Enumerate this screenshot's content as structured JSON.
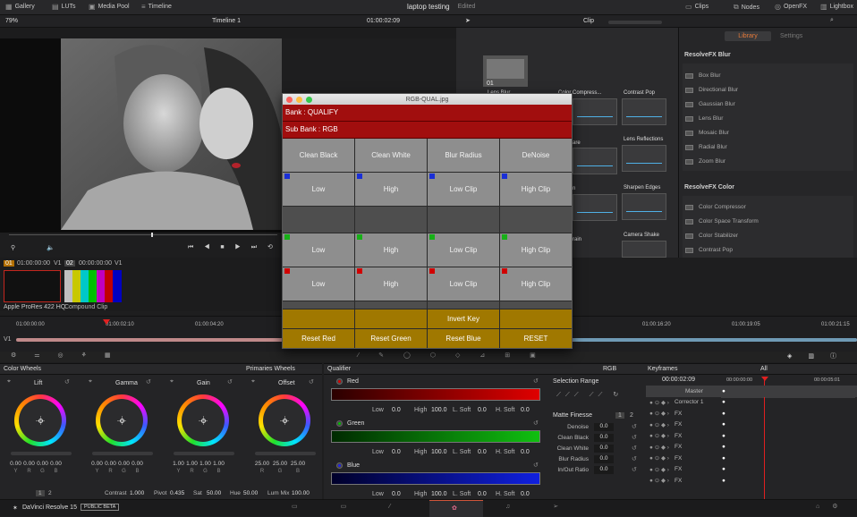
{
  "topbar": {
    "gallery": "Gallery",
    "luts": "LUTs",
    "media_pool": "Media Pool",
    "timeline": "Timeline",
    "project": "laptop testing",
    "edited": "Edited",
    "clips": "Clips",
    "nodes": "Nodes",
    "openfx": "OpenFX",
    "lightbox": "Lightbox"
  },
  "viewerbar": {
    "zoom": "79%",
    "timeline_name": "Timeline 1",
    "timecode": "01:00:02:09",
    "clip_mode": "Clip"
  },
  "library": {
    "tab_library": "Library",
    "tab_settings": "Settings",
    "blur_header": "ResolveFX Blur",
    "blur_items": [
      "Box Blur",
      "Directional Blur",
      "Gaussian Blur",
      "Lens Blur",
      "Mosaic Blur",
      "Radial Blur",
      "Zoom Blur"
    ],
    "color_header": "ResolveFX Color",
    "color_items": [
      "Color Compressor",
      "Color Space Transform",
      "Color Stabilizer",
      "Contrast Pop"
    ]
  },
  "nodes": {
    "node1_num": "01",
    "labels": {
      "lens_blur": "Lens Blur",
      "color_compress": "Color Compress...",
      "contrast_pop": "Contrast Pop",
      "lens_reflections": "Lens Reflections",
      "sharpen_edges": "Sharpen Edges",
      "camera_shake": "Camera Shake",
      "are": "are",
      "n": "n",
      "rain": "rain"
    }
  },
  "clips": {
    "clip1": {
      "num": "01",
      "tc": "01:00:00:00",
      "track": "V1",
      "name": "Apple ProRes 422 HQ"
    },
    "clip2": {
      "num": "02",
      "tc": "00:00:00:00",
      "track": "V1",
      "name": "Compound Clip"
    }
  },
  "timeline": {
    "t0": "01:00:00:00",
    "t1": "01:00:02:10",
    "t2": "01:00:04:20",
    "t3": "01:00:16:20",
    "t4": "01:00:19:05",
    "t5": "01:00:21:15",
    "track": "V1"
  },
  "color_wheels": {
    "title": "Color Wheels",
    "mode": "Primaries Wheels",
    "wheels": [
      {
        "name": "Lift",
        "vals": [
          "0.00",
          "0.00",
          "0.00",
          "0.00"
        ]
      },
      {
        "name": "Gamma",
        "vals": [
          "0.00",
          "0.00",
          "0.00",
          "0.00"
        ]
      },
      {
        "name": "Gain",
        "vals": [
          "1.00",
          "1.00",
          "1.00",
          "1.00"
        ]
      },
      {
        "name": "Offset",
        "vals": [
          "25.00",
          "25.00",
          "25.00"
        ]
      }
    ],
    "ch4": [
      "Y",
      "R",
      "G",
      "B"
    ],
    "ch3": [
      "R",
      "G",
      "B"
    ],
    "footer": {
      "page1": "1",
      "page2": "2",
      "contrast_label": "Contrast",
      "contrast": "1.000",
      "pivot_label": "Pivot",
      "pivot": "0.435",
      "sat_label": "Sat",
      "sat": "50.00",
      "hue_label": "Hue",
      "hue": "50.00",
      "lummix_label": "Lum Mix",
      "lummix": "100.00"
    }
  },
  "qualifier": {
    "title": "Qualifier",
    "mode": "RGB",
    "channels": [
      {
        "name": "Red",
        "low": "0.0",
        "high": "100.0",
        "lsoft": "0.0",
        "hsoft": "0.0"
      },
      {
        "name": "Green",
        "low": "0.0",
        "high": "100.0",
        "lsoft": "0.0",
        "hsoft": "0.0"
      },
      {
        "name": "Blue",
        "low": "0.0",
        "high": "100.0",
        "lsoft": "0.0",
        "hsoft": "0.0"
      }
    ],
    "labels": {
      "low": "Low",
      "high": "High",
      "lsoft": "L. Soft",
      "hsoft": "H. Soft"
    },
    "selection_range": "Selection Range",
    "matte_finesse": "Matte Finesse",
    "mf_pages": [
      "1",
      "2"
    ],
    "matte": [
      {
        "label": "Denoise",
        "val": "0.0"
      },
      {
        "label": "Clean Black",
        "val": "0.0"
      },
      {
        "label": "Clean White",
        "val": "0.0"
      },
      {
        "label": "Blur Radius",
        "val": "0.0"
      },
      {
        "label": "In/Out Ratio",
        "val": "0.0"
      }
    ]
  },
  "keyframes": {
    "title": "Keyframes",
    "filter": "All",
    "timecode": "00:00:02:09",
    "tc_start": "00:00:00:00",
    "tc_end": "00:00:05:01",
    "rows": [
      "Master",
      "Corrector 1",
      "FX",
      "FX",
      "FX",
      "FX",
      "FX",
      "FX",
      "FX"
    ]
  },
  "bottom": {
    "app": "DaVinci Resolve 15",
    "badge": "PUBLIC BETA"
  },
  "popup": {
    "title": "RGB-QUAL.jpg",
    "bank": "Bank : QUALIFY",
    "subbank": "Sub Bank : RGB",
    "row1": [
      "Clean Black",
      "Clean White",
      "Blur Radius",
      "DeNoise"
    ],
    "row2": [
      "Low",
      "High",
      "Low Clip",
      "High Clip"
    ],
    "row3": [
      "Low",
      "High",
      "Low Clip",
      "High Clip"
    ],
    "row4": [
      "Low",
      "High",
      "Low Clip",
      "High Clip"
    ],
    "invert": "Invert Key",
    "row6": [
      "Reset Red",
      "Reset Green",
      "Reset Blue",
      "RESET"
    ],
    "colors": {
      "red": "#d10000",
      "green": "#17b017",
      "blue": "#1a2fd6"
    }
  }
}
